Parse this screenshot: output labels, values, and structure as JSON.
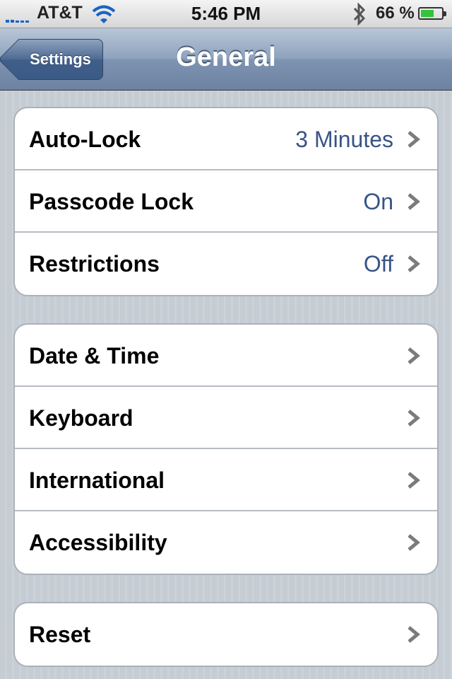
{
  "status_bar": {
    "carrier": "AT&T",
    "time": "5:46 PM",
    "battery_percent": "66 %",
    "battery_level": 0.66,
    "signal_icon": "signal-bars-icon",
    "wifi_icon": "wifi-icon",
    "bluetooth_icon": "bluetooth-icon",
    "battery_icon": "battery-icon"
  },
  "nav": {
    "back_label": "Settings",
    "title": "General"
  },
  "groups": [
    {
      "rows": [
        {
          "label": "Auto-Lock",
          "value": "3 Minutes"
        },
        {
          "label": "Passcode Lock",
          "value": "On"
        },
        {
          "label": "Restrictions",
          "value": "Off"
        }
      ]
    },
    {
      "rows": [
        {
          "label": "Date & Time",
          "value": ""
        },
        {
          "label": "Keyboard",
          "value": ""
        },
        {
          "label": "International",
          "value": ""
        },
        {
          "label": "Accessibility",
          "value": ""
        }
      ]
    },
    {
      "rows": [
        {
          "label": "Reset",
          "value": ""
        }
      ]
    }
  ],
  "colors": {
    "value_text": "#385487",
    "background": "#c5ccd4",
    "battery_fill": "#33c43a",
    "signal": "#1a63c4"
  }
}
